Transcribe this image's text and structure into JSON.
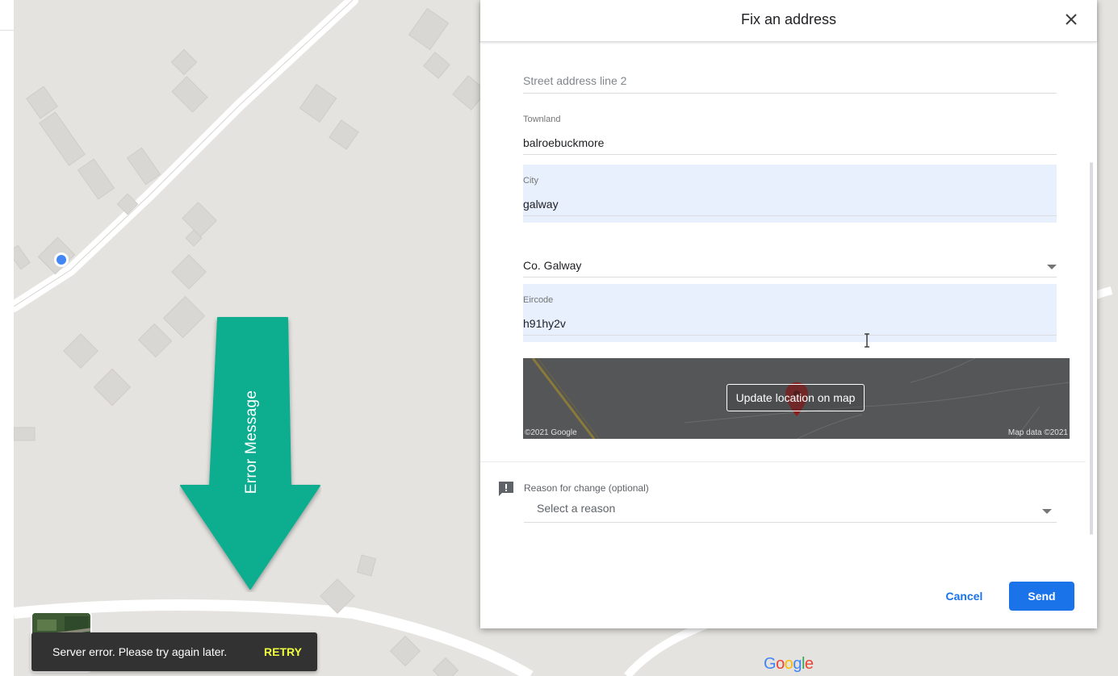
{
  "dialog": {
    "title": "Fix an address",
    "fields": {
      "street_line2_placeholder": "Street address line 2",
      "townland_label": "Townland",
      "townland_value": "balroebuckmore",
      "city_label": "City",
      "city_value": "galway",
      "county_value": "Co. Galway",
      "eircode_label": "Eircode",
      "eircode_value": "h91hy2v"
    },
    "mini_map": {
      "update_button": "Update location on map",
      "copyright": "©2021 Google",
      "map_data": "Map data ©2021"
    },
    "reason": {
      "label": "Reason for change (optional)",
      "value": "Select a reason"
    },
    "buttons": {
      "cancel": "Cancel",
      "send": "Send"
    }
  },
  "annotation": {
    "arrow_label": "Error Message",
    "arrow_color": "#0aae90"
  },
  "snackbar": {
    "message": "Server error. Please try again later.",
    "action": "RETRY"
  },
  "colors": {
    "accent": "#1a73e8",
    "autofill": "#e8f0fe",
    "retry": "#eeff41"
  }
}
